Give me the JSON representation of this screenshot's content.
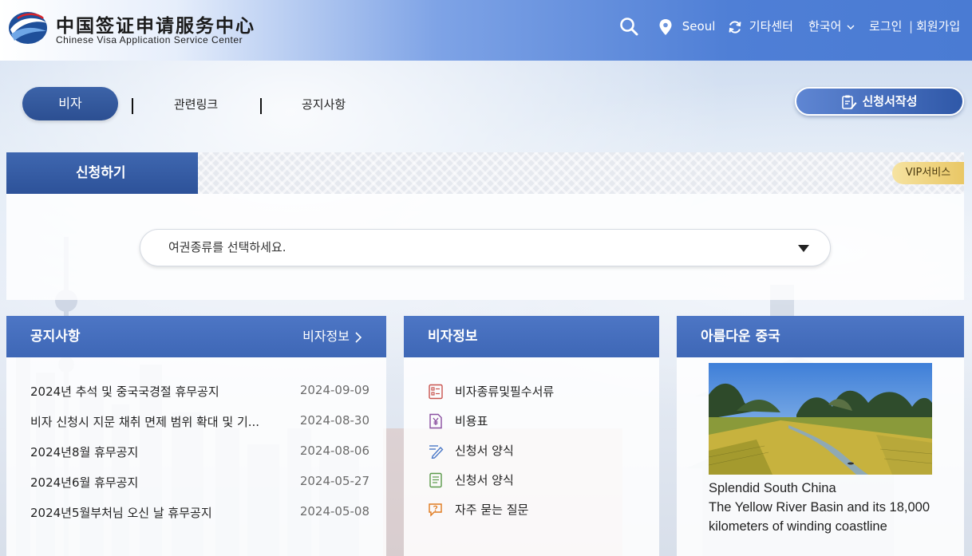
{
  "header": {
    "logo_cn": "中国签证申请服务中心",
    "logo_en": "Chinese Visa Application Service Center",
    "location": "Seoul",
    "other_center": "기타센터",
    "language": "한국어",
    "login": "로그인",
    "separator": "|",
    "join": "회원가입"
  },
  "nav": {
    "visa": "비자",
    "links": "관련링크",
    "notice": "공지사항",
    "apply_button": "신청서작성"
  },
  "apply": {
    "tab": "신청하기",
    "vip": "VIP서비스",
    "passport_placeholder": "여권종류를 선택하세요."
  },
  "notice_card": {
    "title": "공지사항",
    "more": "비자정보",
    "items": [
      {
        "title": "2024년 추석 및 중국국경절 휴무공지",
        "date": "2024-09-09"
      },
      {
        "title": "비자 신청시 지문 채취 면제 범위 확대 및 기...",
        "date": "2024-08-30"
      },
      {
        "title": "2024년8월 휴무공지",
        "date": "2024-08-06"
      },
      {
        "title": "2024년6월 휴무공지",
        "date": "2024-05-27"
      },
      {
        "title": "2024년5월부처님 오신 날 휴무공지",
        "date": "2024-05-08"
      }
    ]
  },
  "visa_card": {
    "title": "비자정보",
    "items": [
      {
        "label": "비자종류및필수서류",
        "icon": "document-list-icon"
      },
      {
        "label": "비용표",
        "icon": "yen-icon"
      },
      {
        "label": "신청서 양식",
        "icon": "pen-icon"
      },
      {
        "label": "신청서 양식",
        "icon": "form-icon"
      },
      {
        "label": "자주 묻는 질문",
        "icon": "faq-icon"
      }
    ]
  },
  "china_card": {
    "title": "아름다운 중국",
    "caption": "Splendid South China\nThe Yellow River Basin and its 18,000 kilometers of winding coastline"
  },
  "colors": {
    "primary": "#2c4f92",
    "header_blue": "#4f7fd6",
    "vip_gold": "#e9c765",
    "faq_orange": "#e07b20",
    "yen_purple": "#8a4fa0",
    "doc_red": "#c9544f",
    "form_green": "#5a9a4a",
    "pen_blue": "#4d7ac8"
  }
}
